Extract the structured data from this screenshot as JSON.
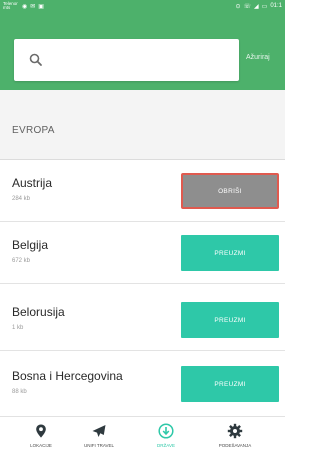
{
  "status_bar": {
    "carrier": "Telenor mts",
    "time": "01:1"
  },
  "search": {
    "placeholder": "",
    "refresh_label": "Ažuriraj"
  },
  "section": {
    "title": "EVROPA"
  },
  "countries": [
    {
      "name": "Austrija",
      "size": "284 kb",
      "action": "OBRIŠI"
    },
    {
      "name": "Belgija",
      "size": "672 kb",
      "action": "PREUZMI"
    },
    {
      "name": "Belorusija",
      "size": "1 kb",
      "action": "PREUZMI"
    },
    {
      "name": "Bosna i Hercegovina",
      "size": "88 kb",
      "action": "PREUZMI"
    }
  ],
  "nav": [
    {
      "label": "LOKACIJE",
      "icon": "location-pin-icon"
    },
    {
      "label": "UNIFI TRAVEL",
      "icon": "airplane-icon"
    },
    {
      "label": "DRŽAVE",
      "icon": "download-circle-icon",
      "active": true
    },
    {
      "label": "PODEŠAVANJA",
      "icon": "gear-icon"
    }
  ],
  "colors": {
    "brand": "#4db16b",
    "accent": "#2ec8a8",
    "delete_button": "#8e8e8e",
    "delete_border": "#e05a4f"
  }
}
